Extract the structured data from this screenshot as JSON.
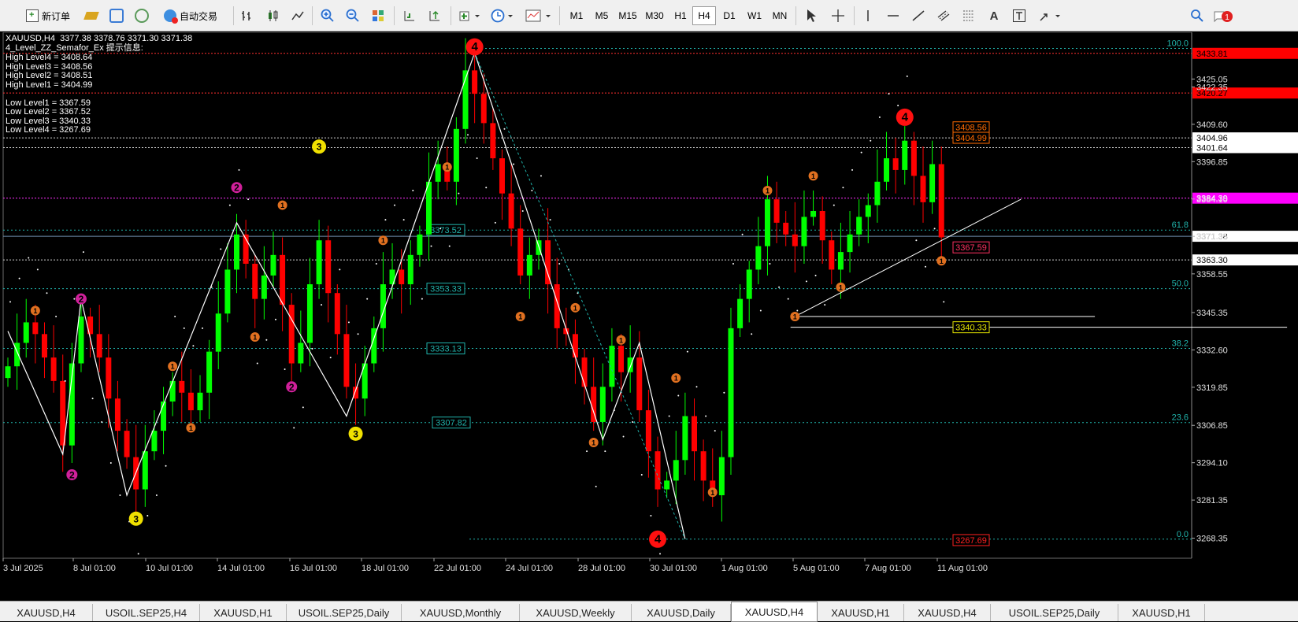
{
  "toolbar": {
    "new_order": "新订单",
    "auto_trade": "自动交易",
    "timeframes": [
      "M1",
      "M5",
      "M15",
      "M30",
      "H1",
      "H4",
      "D1",
      "W1",
      "MN"
    ],
    "active_timeframe": "H4"
  },
  "chart_data": {
    "type": "candlestick",
    "symbol_line": "XAUUSD,H4  3377.38 3378.76 3371.30 3371.38",
    "indicator_title": "4_Level_ZZ_Semafor_Ex 提示信息:",
    "indicator_lines": [
      "High Level4 = 3408.64",
      "High Level3 = 3408.56",
      "High Level2 = 3408.51",
      "High Level1 = 3404.99",
      "",
      "Low Level1 = 3367.59",
      "Low Level2 = 3367.52",
      "Low Level3 = 3340.33",
      "Low Level4 = 3267.69"
    ],
    "ylim": [
      3261.5,
      3441
    ],
    "y_ticks": [
      "3425.05",
      "3422.35",
      "3409.60",
      "3396.85",
      "3384.10",
      "3371.35",
      "3358.55",
      "3345.35",
      "3332.60",
      "3319.85",
      "3306.85",
      "3294.10",
      "3281.35",
      "3268.35"
    ],
    "y_tick_values": [
      3425.05,
      3422.35,
      3409.6,
      3396.85,
      3384.1,
      3371.35,
      3358.55,
      3345.35,
      3332.6,
      3319.85,
      3306.85,
      3294.1,
      3281.35,
      3268.35
    ],
    "x_ticks": [
      "3 Jul 2025",
      "8 Jul 01:00",
      "10 Jul 01:00",
      "14 Jul 01:00",
      "16 Jul 01:00",
      "18 Jul 01:00",
      "22 Jul 01:00",
      "24 Jul 01:00",
      "28 Jul 01:00",
      "30 Jul 01:00",
      "1 Aug 01:00",
      "5 Aug 01:00",
      "7 Aug 01:00",
      "11 Aug 01:00"
    ],
    "price_labels": [
      {
        "text": "3433.81",
        "value": 3433.81,
        "color": "#ff0000"
      },
      {
        "text": "3420.27",
        "value": 3420.27,
        "color": "#ff0000"
      },
      {
        "text": "3404.96",
        "value": 3404.96,
        "color": "#000000"
      },
      {
        "text": "3401.64",
        "value": 3401.64,
        "color": "#000000"
      },
      {
        "text": "3384.39",
        "value": 3384.39,
        "color": "#ff00ff"
      },
      {
        "text": "3371.38",
        "value": 3371.38,
        "color": "#000000"
      },
      {
        "text": "3363.30",
        "value": 3363.3,
        "color": "#000000"
      }
    ],
    "fib_levels": [
      {
        "label": "100.0",
        "value": 3435.5
      },
      {
        "label": "61.8",
        "value": 3373.5
      },
      {
        "label": "50.0",
        "value": 3353.5
      },
      {
        "label": "38.2",
        "value": 3333.1
      },
      {
        "label": "23.6",
        "value": 3307.8
      },
      {
        "label": "0.0",
        "value": 3268.0
      }
    ],
    "fib_boxes": [
      "3373.52",
      "3353.33",
      "3333.13",
      "3307.82"
    ],
    "level_boxes": [
      {
        "text": "3408.56",
        "value": 3408.56,
        "color": "#ff6a00"
      },
      {
        "text": "3404.99",
        "value": 3404.99,
        "color": "#ff6a00"
      },
      {
        "text": "3367.59",
        "value": 3367.59,
        "color": "#ff3060"
      },
      {
        "text": "3340.33",
        "value": 3340.33,
        "color": "#e6e600"
      },
      {
        "text": "3267.69",
        "value": 3267.69,
        "color": "#ff2020"
      }
    ],
    "semafor": [
      {
        "i": 3,
        "v": 3346,
        "lvl": "1"
      },
      {
        "i": 7,
        "v": 3290,
        "lvl": "2"
      },
      {
        "i": 8,
        "v": 3350,
        "lvl": "2"
      },
      {
        "i": 14,
        "v": 3275,
        "lvl": "3"
      },
      {
        "i": 18,
        "v": 3327,
        "lvl": "1"
      },
      {
        "i": 20,
        "v": 3306,
        "lvl": "1"
      },
      {
        "i": 25,
        "v": 3388,
        "lvl": "2"
      },
      {
        "i": 27,
        "v": 3337,
        "lvl": "1"
      },
      {
        "i": 30,
        "v": 3382,
        "lvl": "1"
      },
      {
        "i": 31,
        "v": 3320,
        "lvl": "2"
      },
      {
        "i": 34,
        "v": 3402,
        "lvl": "3"
      },
      {
        "i": 38,
        "v": 3304,
        "lvl": "3"
      },
      {
        "i": 41,
        "v": 3370,
        "lvl": "1"
      },
      {
        "i": 48,
        "v": 3395,
        "lvl": "1"
      },
      {
        "i": 51,
        "v": 3436,
        "lvl": "4"
      },
      {
        "i": 56,
        "v": 3344,
        "lvl": "1"
      },
      {
        "i": 62,
        "v": 3347,
        "lvl": "1"
      },
      {
        "i": 64,
        "v": 3301,
        "lvl": "1"
      },
      {
        "i": 67,
        "v": 3336,
        "lvl": "1"
      },
      {
        "i": 71,
        "v": 3268,
        "lvl": "4"
      },
      {
        "i": 73,
        "v": 3323,
        "lvl": "1"
      },
      {
        "i": 77,
        "v": 3284,
        "lvl": "1"
      },
      {
        "i": 83,
        "v": 3387,
        "lvl": "1"
      },
      {
        "i": 86,
        "v": 3344,
        "lvl": "1"
      },
      {
        "i": 88,
        "v": 3392,
        "lvl": "1"
      },
      {
        "i": 91,
        "v": 3354,
        "lvl": "1"
      },
      {
        "i": 98,
        "v": 3412,
        "lvl": "4"
      },
      {
        "i": 102,
        "v": 3363,
        "lvl": "1"
      }
    ],
    "zigzag": [
      {
        "i": 0,
        "v": 3339
      },
      {
        "i": 6,
        "v": 3297
      },
      {
        "i": 8,
        "v": 3350
      },
      {
        "i": 13,
        "v": 3283
      },
      {
        "i": 25,
        "v": 3376
      },
      {
        "i": 37,
        "v": 3310
      },
      {
        "i": 51,
        "v": 3434
      },
      {
        "i": 65,
        "v": 3302
      },
      {
        "i": 69,
        "v": 3335
      },
      {
        "i": 74,
        "v": 3268
      }
    ],
    "candles_close": [
      3327,
      3335,
      3342,
      3338,
      3330,
      3322,
      3300,
      3328,
      3344,
      3338,
      3330,
      3316,
      3305,
      3296,
      3285,
      3298,
      3305,
      3315,
      3322,
      3318,
      3312,
      3318,
      3332,
      3345,
      3360,
      3372,
      3362,
      3350,
      3358,
      3365,
      3348,
      3328,
      3335,
      3355,
      3370,
      3352,
      3338,
      3320,
      3316,
      3328,
      3340,
      3355,
      3360,
      3355,
      3365,
      3372,
      3390,
      3396,
      3390,
      3408,
      3428,
      3420,
      3410,
      3398,
      3386,
      3374,
      3358,
      3365,
      3370,
      3355,
      3340,
      3338,
      3330,
      3320,
      3308,
      3320,
      3334,
      3325,
      3330,
      3312,
      3298,
      3285,
      3288,
      3295,
      3310,
      3298,
      3288,
      3283,
      3296,
      3340,
      3350,
      3360,
      3368,
      3384,
      3376,
      3372,
      3368,
      3378,
      3380,
      3370,
      3360,
      3366,
      3372,
      3378,
      3382,
      3390,
      3398,
      3394,
      3404,
      3392,
      3383,
      3396,
      3371
    ],
    "trendline": {
      "from": {
        "i": 86,
        "v": 3344
      },
      "to": {
        "i": 110,
        "v": 3378
      }
    },
    "horizontal_white_lines": [
      {
        "from_i": 86,
        "to_i": 105,
        "v": 3344
      },
      {
        "from_i": 85,
        "to_i": 126,
        "v": 3340.33
      }
    ],
    "legend": "none",
    "grid": false
  },
  "tabs": [
    "XAUUSD,H4",
    "USOIL.SEP25,H4",
    "XAUUSD,H1",
    "USOIL.SEP25,Daily",
    "XAUUSD,Monthly",
    "XAUUSD,Weekly",
    "XAUUSD,Daily",
    "XAUUSD,H4",
    "XAUUSD,H1",
    "XAUUSD,H4",
    "USOIL.SEP25,Daily",
    "XAUUSD,H1"
  ],
  "active_tab_index": 7,
  "colors": {
    "bull": "#00ff00",
    "bear": "#ff0000",
    "background": "#000000",
    "fib": "#20b2aa"
  }
}
